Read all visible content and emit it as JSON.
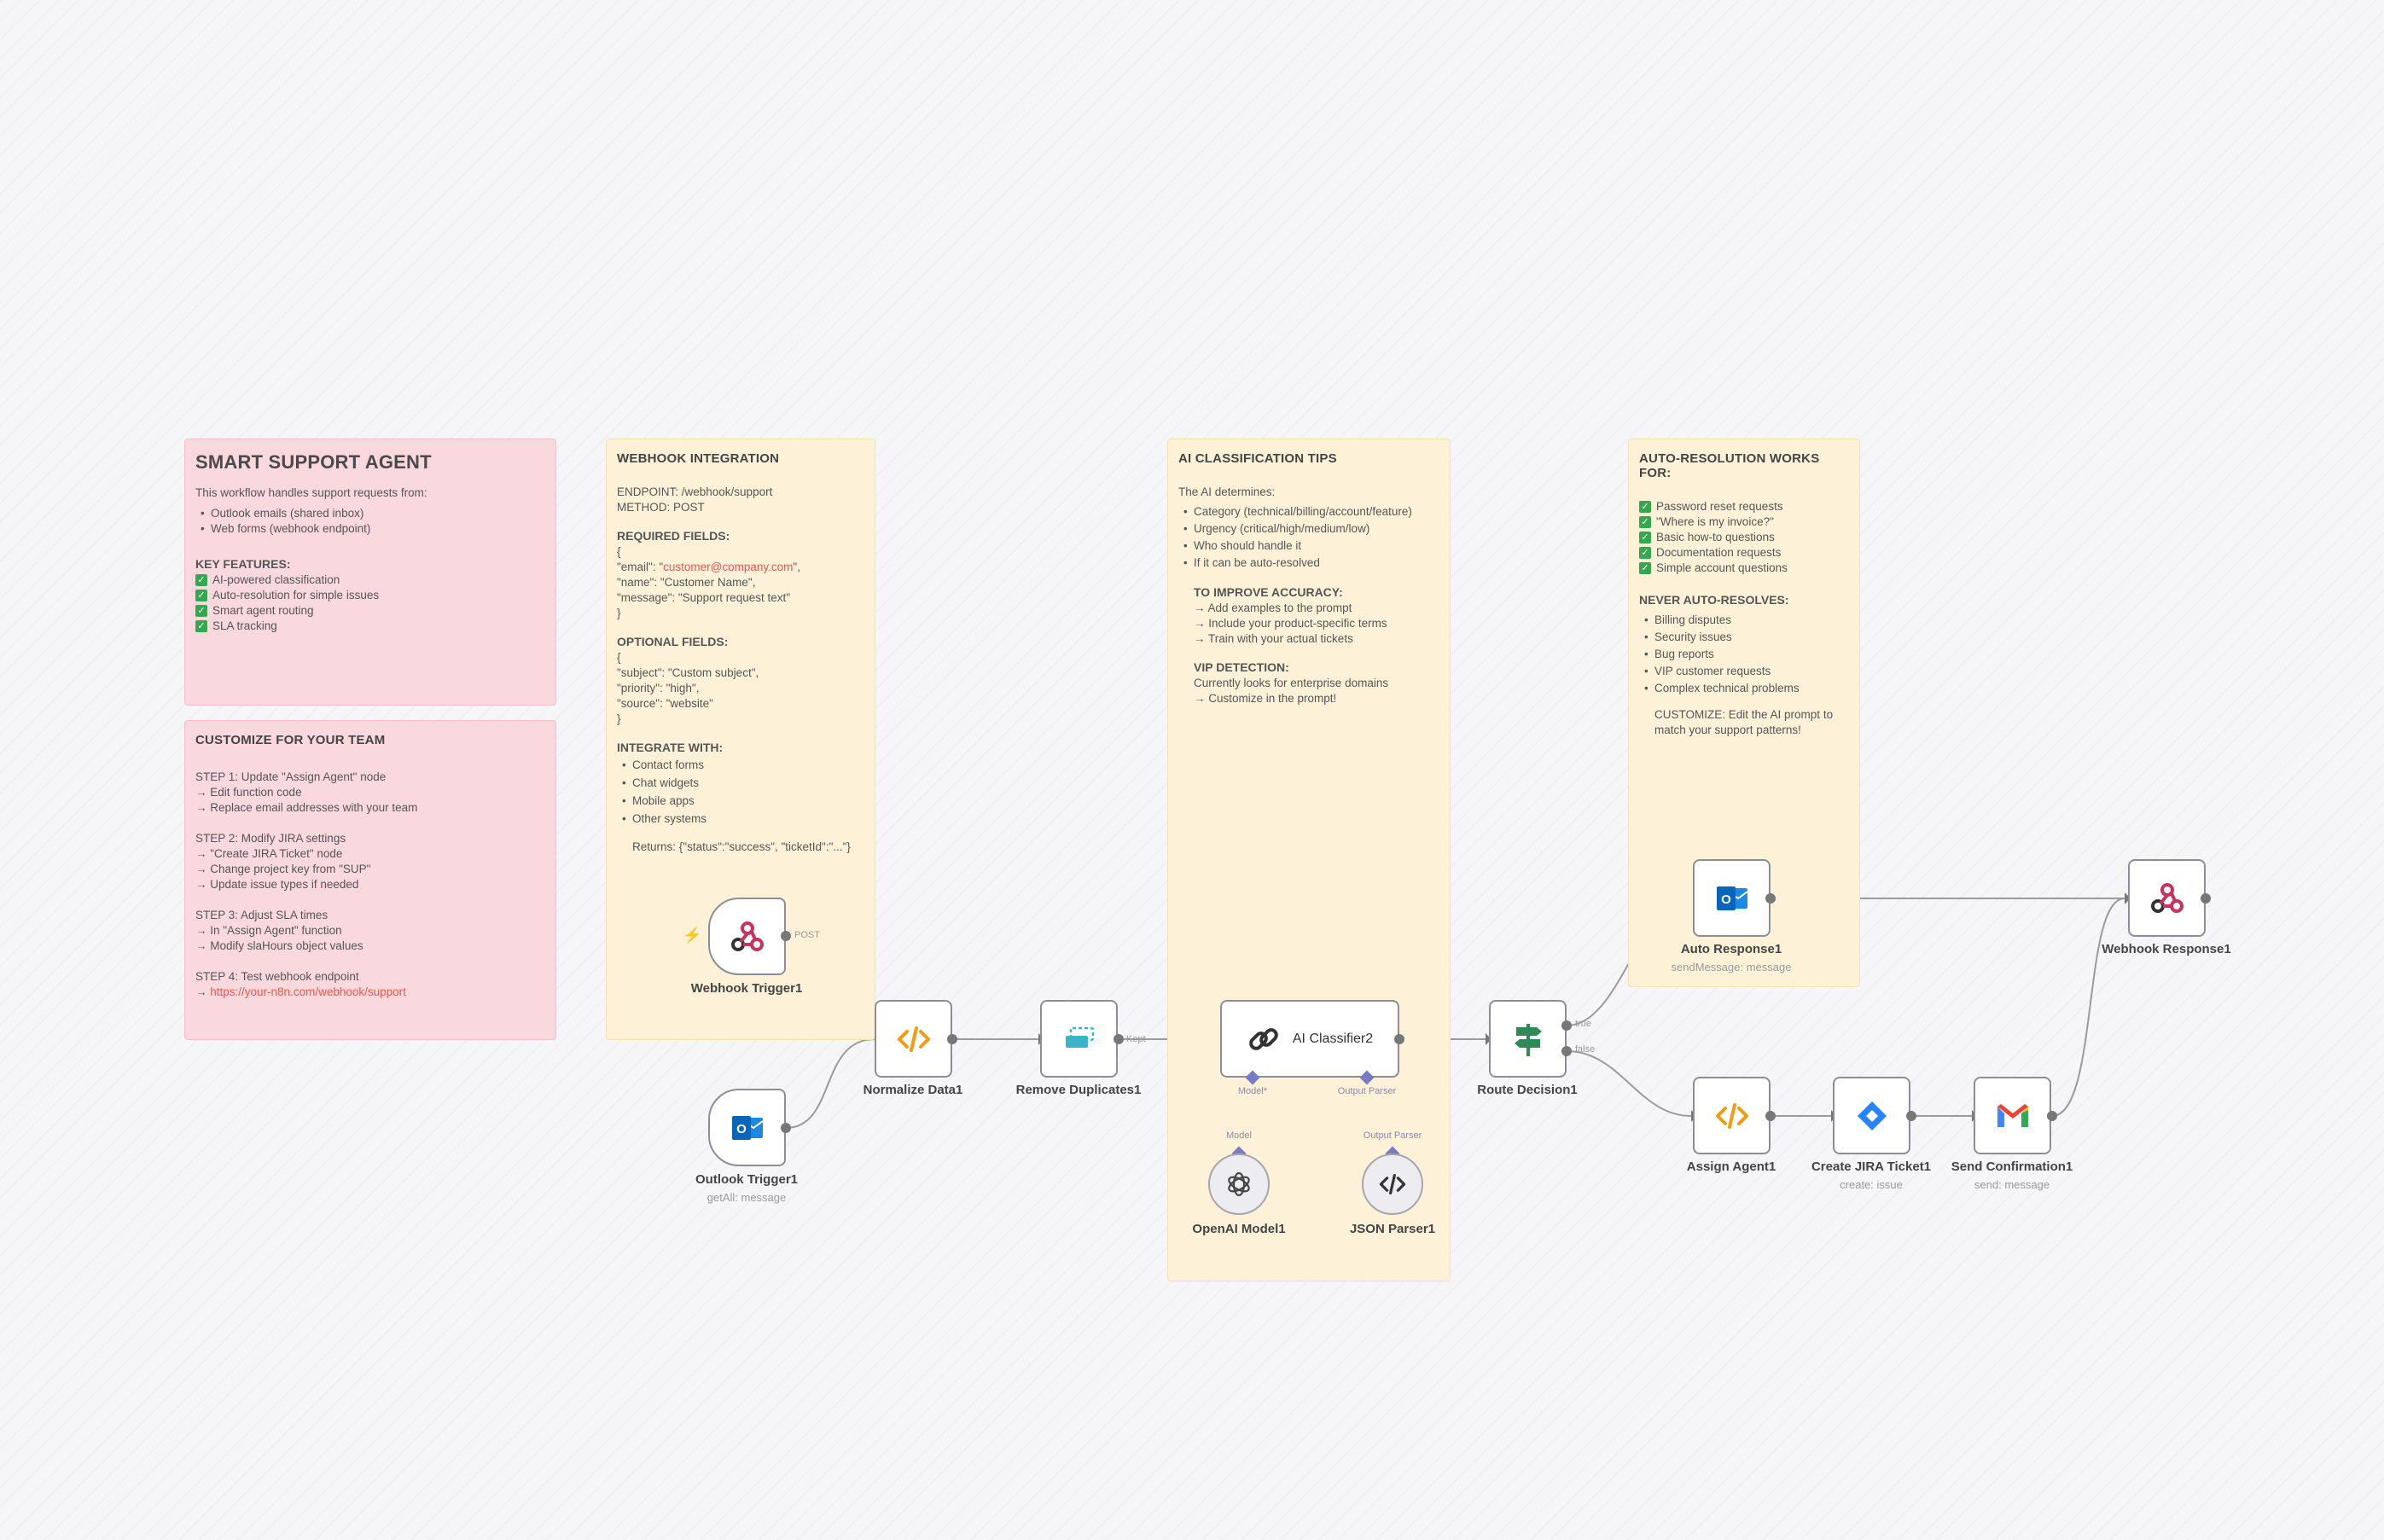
{
  "colors": {
    "pink_sticky": "#f9d9de",
    "yellow_sticky": "#fdf2d8",
    "check_green": "#34a84f",
    "link_red": "#e8594a",
    "ai_port": "#7a7bc7"
  },
  "stickies": {
    "main": {
      "title": "SMART SUPPORT AGENT",
      "intro": "This workflow handles support requests from:",
      "sources": [
        "Outlook emails (shared inbox)",
        "Web forms (webhook endpoint)"
      ],
      "features_title": "KEY FEATURES:",
      "features": [
        "AI-powered classification",
        "Auto-resolution for simple issues",
        "Smart agent routing",
        "SLA tracking"
      ]
    },
    "customize": {
      "title": "CUSTOMIZE FOR YOUR TEAM",
      "lines": [
        "STEP 1: Update \"Assign Agent\" node",
        "→ Edit function code",
        "→ Replace email addresses with your team",
        "",
        "STEP 2: Modify JIRA settings",
        "→ \"Create JIRA Ticket\" node",
        "→ Change project key from \"SUP\"",
        "→ Update issue types if needed",
        "",
        "STEP 3: Adjust SLA times",
        "→ In \"Assign Agent\" function",
        "→ Modify slaHours object values",
        "",
        "STEP 4: Test webhook endpoint"
      ],
      "link_prefix": "→ ",
      "link": "https://your-n8n.com/webhook/support"
    },
    "webhook": {
      "title": "WEBHOOK INTEGRATION",
      "endpoint": "ENDPOINT: /webhook/support",
      "method": "METHOD: POST",
      "required_title": "REQUIRED FIELDS:",
      "brace_open": "{",
      "email_prefix": "\"email\": \"",
      "email_value": "customer@company.com",
      "email_suffix": "\",",
      "name_line": "\"name\": \"Customer Name\",",
      "message_line": "\"message\": \"Support request text\"",
      "brace_close": "}",
      "optional_title": "OPTIONAL FIELDS:",
      "optional_lines": [
        "{",
        "\"subject\": \"Custom subject\",",
        "\"priority\": \"high\",",
        "\"source\": \"website\"",
        "}"
      ],
      "integrate_title": "INTEGRATE WITH:",
      "integrate": [
        "Contact forms",
        "Chat widgets",
        "Mobile apps",
        "Other systems"
      ],
      "returns": "Returns: {\"status\":\"success\", \"ticketId\":\"...\"}"
    },
    "ai_tips": {
      "title": "AI CLASSIFICATION TIPS",
      "intro": "The AI determines:",
      "determines": [
        "Category (technical/billing/account/feature)",
        "Urgency (critical/high/medium/low)",
        "Who should handle it",
        "If it can be auto-resolved"
      ],
      "accuracy_title": "TO IMPROVE ACCURACY:",
      "accuracy": [
        "→ Add examples to the prompt",
        "→ Include your product-specific terms",
        "→ Train with your actual tickets"
      ],
      "vip_title": "VIP DETECTION:",
      "vip": [
        "Currently looks for enterprise domains",
        "→ Customize in the prompt!"
      ]
    },
    "auto_resolution": {
      "title": "AUTO-RESOLUTION WORKS FOR:",
      "works_for": [
        "Password reset requests",
        "\"Where is my invoice?\"",
        "Basic how-to questions",
        "Documentation requests",
        "Simple account questions"
      ],
      "never_title": "NEVER AUTO-RESOLVES:",
      "never": [
        "Billing disputes",
        "Security issues",
        "Bug reports",
        "VIP customer requests",
        "Complex technical problems"
      ],
      "customize": [
        "CUSTOMIZE: Edit the AI prompt to",
        "match your support patterns!"
      ]
    }
  },
  "nodes": {
    "webhook_trigger": {
      "label": "Webhook Trigger1",
      "icon": "webhook-icon",
      "port_label": "POST"
    },
    "outlook_trigger": {
      "label": "Outlook Trigger1",
      "sub": "getAll: message",
      "icon": "outlook-icon"
    },
    "normalize": {
      "label": "Normalize Data1",
      "icon": "code-icon"
    },
    "remove_dup": {
      "label": "Remove Duplicates1",
      "icon": "remove-duplicates-icon",
      "port_label": "Kept"
    },
    "ai_classifier": {
      "label": "AI Classifier2",
      "icon": "link-chain-icon",
      "model_label": "Model*",
      "parser_label": "Output Parser"
    },
    "openai": {
      "label": "OpenAI Model1",
      "icon": "openai-icon",
      "port_label": "Model"
    },
    "json_parser": {
      "label": "JSON Parser1",
      "icon": "code-icon",
      "port_label": "Output Parser"
    },
    "route": {
      "label": "Route Decision1",
      "icon": "signpost-icon",
      "true_label": "true",
      "false_label": "false"
    },
    "auto_response": {
      "label": "Auto Response1",
      "sub": "sendMessage: message",
      "icon": "outlook-icon"
    },
    "webhook_response": {
      "label": "Webhook Response1",
      "icon": "webhook-icon"
    },
    "assign_agent": {
      "label": "Assign Agent1",
      "icon": "code-icon"
    },
    "jira": {
      "label": "Create JIRA Ticket1",
      "sub": "create: issue",
      "icon": "jira-icon"
    },
    "gmail": {
      "label": "Send Confirmation1",
      "sub": "send: message",
      "icon": "gmail-icon"
    }
  },
  "icons": {
    "trigger_bolt": "lightning-bolt-icon"
  }
}
